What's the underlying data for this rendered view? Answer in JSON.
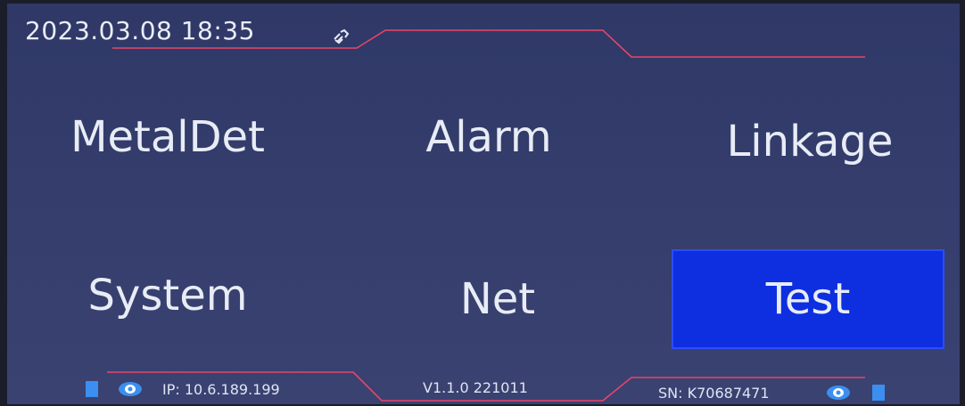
{
  "status_bar": {
    "datetime": "2023.03.08 18:35",
    "link_icon": "link-icon"
  },
  "menu": {
    "items": [
      {
        "label": "MetalDet",
        "selected": false
      },
      {
        "label": "Alarm",
        "selected": false
      },
      {
        "label": "Linkage",
        "selected": false
      },
      {
        "label": "System",
        "selected": false
      },
      {
        "label": "Net",
        "selected": false
      },
      {
        "label": "Test",
        "selected": true
      }
    ]
  },
  "footer": {
    "ip": "IP: 10.6.189.199",
    "version": "V1.1.0 221011",
    "sn": "SN: K70687471",
    "left_indicator_icon": "eye-icon",
    "right_indicator_icon": "eye-icon"
  },
  "colors": {
    "background": "#343d6c",
    "accent_line": "#e8456a",
    "selected": "#0d2fe0",
    "text": "#e8ecf6",
    "indicator": "#3a8ff0"
  }
}
